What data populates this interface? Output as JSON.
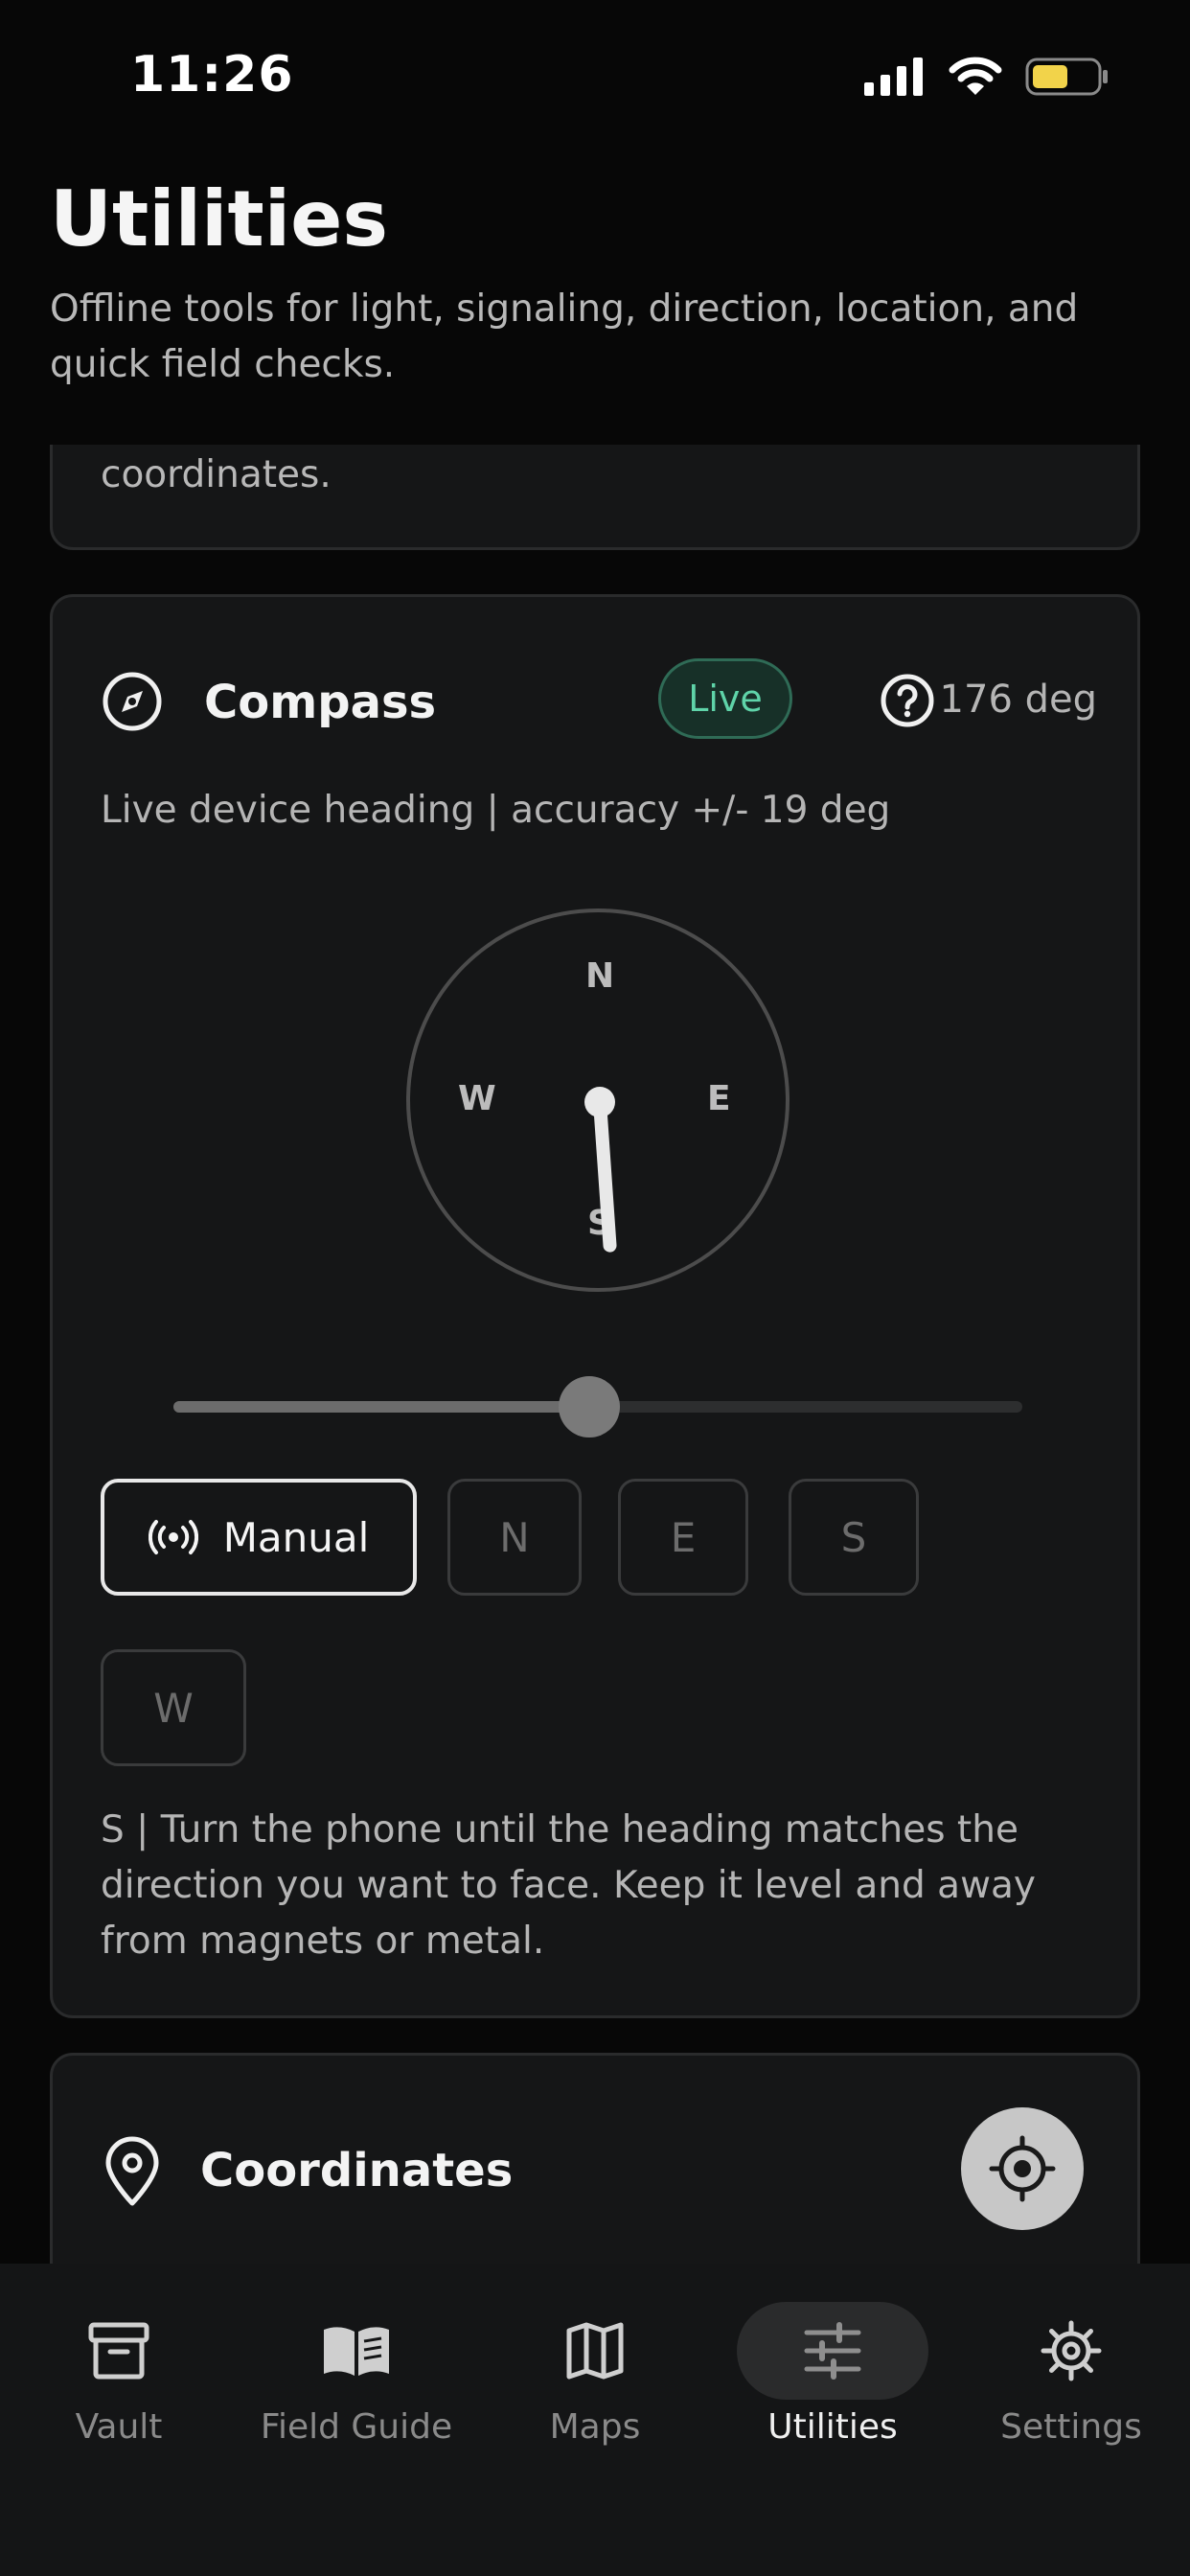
{
  "status_bar": {
    "time": "11:26"
  },
  "header": {
    "title": "Utilities",
    "subtitle": "Offline tools for light, signaling, direction, location, and quick field checks."
  },
  "previous_card": {
    "text_partial": "Degrees-Minutes-Seconds, and UTM/MGRS coordinates."
  },
  "compass": {
    "title": "Compass",
    "live_badge": "Live",
    "heading_readout": "176 deg",
    "subtitle": "Live device heading | accuracy +/- 19 deg",
    "dial": {
      "north": "N",
      "east": "E",
      "south": "S",
      "west": "W",
      "heading_deg": 176
    },
    "slider_value": 0.49,
    "manual_label": "Manual",
    "direction_buttons": [
      "N",
      "E",
      "S",
      "W"
    ],
    "note": "S | Turn the phone until the heading matches the direction you want to face. Keep it level and away from magnets or metal."
  },
  "coordinates": {
    "title": "Coordinates"
  },
  "tabs": [
    {
      "label": "Vault",
      "icon": "archive-icon",
      "active": false
    },
    {
      "label": "Field Guide",
      "icon": "book-icon",
      "active": false
    },
    {
      "label": "Maps",
      "icon": "map-icon",
      "active": false
    },
    {
      "label": "Utilities",
      "icon": "sliders-icon",
      "active": true
    },
    {
      "label": "Settings",
      "icon": "gear-icon",
      "active": false
    }
  ],
  "colors": {
    "background": "#070707",
    "card": "#151617",
    "live_accent": "#5fd4a9",
    "battery": "#f2d34a"
  }
}
